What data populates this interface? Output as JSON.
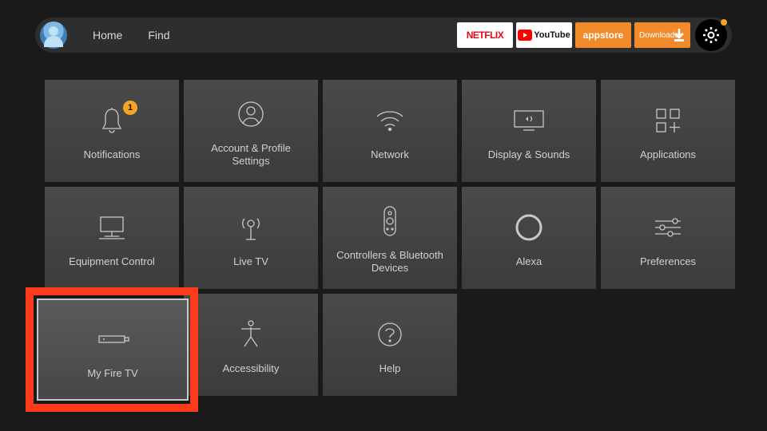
{
  "topbar": {
    "nav": [
      {
        "label": "Home"
      },
      {
        "label": "Find"
      }
    ],
    "apps": [
      {
        "name": "netflix",
        "label": "NETFLIX"
      },
      {
        "name": "youtube",
        "label": "YouTube"
      },
      {
        "name": "appstore",
        "label": "appstore"
      },
      {
        "name": "downloader",
        "label": "Downloader"
      }
    ],
    "settings_has_notification": true
  },
  "tiles": {
    "notifications": {
      "label": "Notifications",
      "badge": "1"
    },
    "account": {
      "label": "Account & Profile Settings"
    },
    "network": {
      "label": "Network"
    },
    "display": {
      "label": "Display & Sounds"
    },
    "applications": {
      "label": "Applications"
    },
    "equipment": {
      "label": "Equipment Control"
    },
    "livetv": {
      "label": "Live TV"
    },
    "controllers": {
      "label": "Controllers & Bluetooth Devices"
    },
    "alexa": {
      "label": "Alexa"
    },
    "preferences": {
      "label": "Preferences"
    },
    "myfiretv": {
      "label": "My Fire TV"
    },
    "accessibility": {
      "label": "Accessibility"
    },
    "help": {
      "label": "Help"
    }
  },
  "selected_tile": "myfiretv"
}
